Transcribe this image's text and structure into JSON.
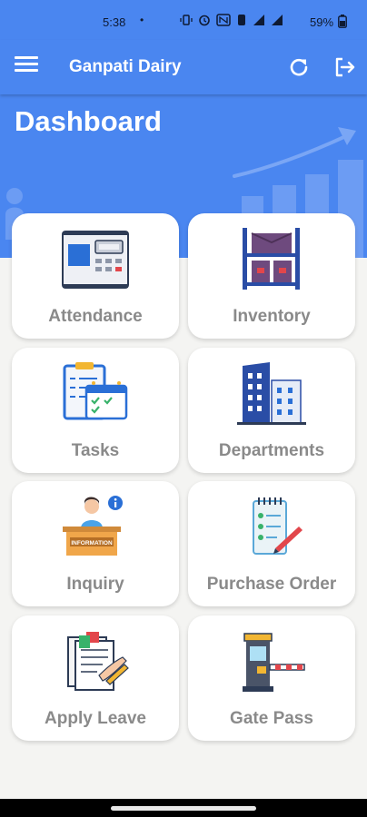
{
  "status_bar": {
    "time": "5:38",
    "dot": "•",
    "battery_percent": "59%"
  },
  "app_bar": {
    "title": "Ganpati Dairy",
    "icons": [
      "menu-icon",
      "refresh-icon",
      "logout-icon"
    ]
  },
  "hero": {
    "title": "Dashboard"
  },
  "tiles": [
    {
      "label": "Attendance",
      "icon": "attendance-icon"
    },
    {
      "label": "Inventory",
      "icon": "inventory-icon"
    },
    {
      "label": "Tasks",
      "icon": "tasks-icon"
    },
    {
      "label": "Departments",
      "icon": "departments-icon"
    },
    {
      "label": "Inquiry",
      "icon": "inquiry-icon"
    },
    {
      "label": "Purchase Order",
      "icon": "purchase-order-icon"
    },
    {
      "label": "Apply Leave",
      "icon": "apply-leave-icon"
    },
    {
      "label": "Gate Pass",
      "icon": "gate-pass-icon"
    }
  ],
  "colors": {
    "primary": "#4a86f0",
    "background": "#f4f4f2",
    "card": "#ffffff",
    "label": "#8a8a8a"
  }
}
